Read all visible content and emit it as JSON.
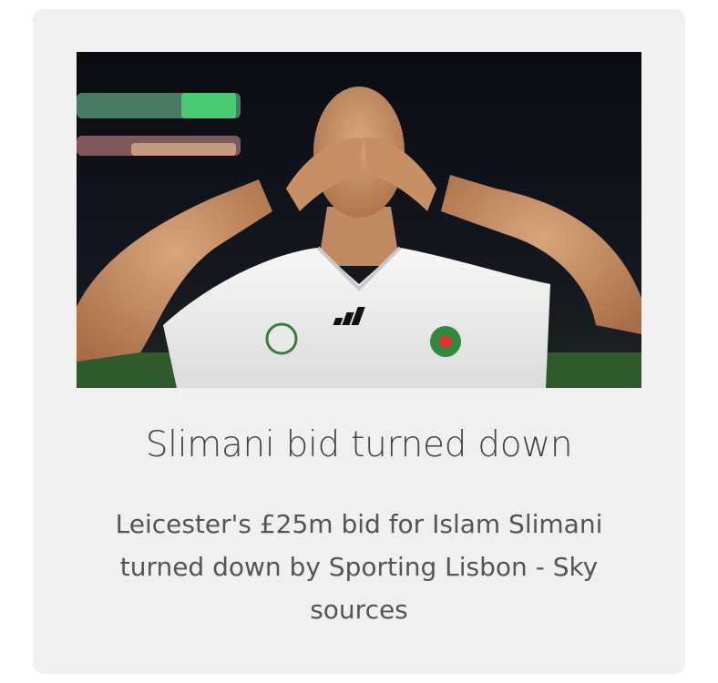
{
  "article_card": {
    "image": {
      "subject": "footballer blowing kisses with both hands, white jersey with adidas logo and crest",
      "icon": "photo-thumbnail"
    },
    "headline": "Slimani bid turned down",
    "summary": "Leicester's £25m bid for Islam Slimani turned down by Sporting Lisbon - Sky sources"
  },
  "colors": {
    "card_background": "#f0f0f0",
    "headline_text": "#444444",
    "summary_text": "#555555",
    "page_background": "#ffffff"
  }
}
